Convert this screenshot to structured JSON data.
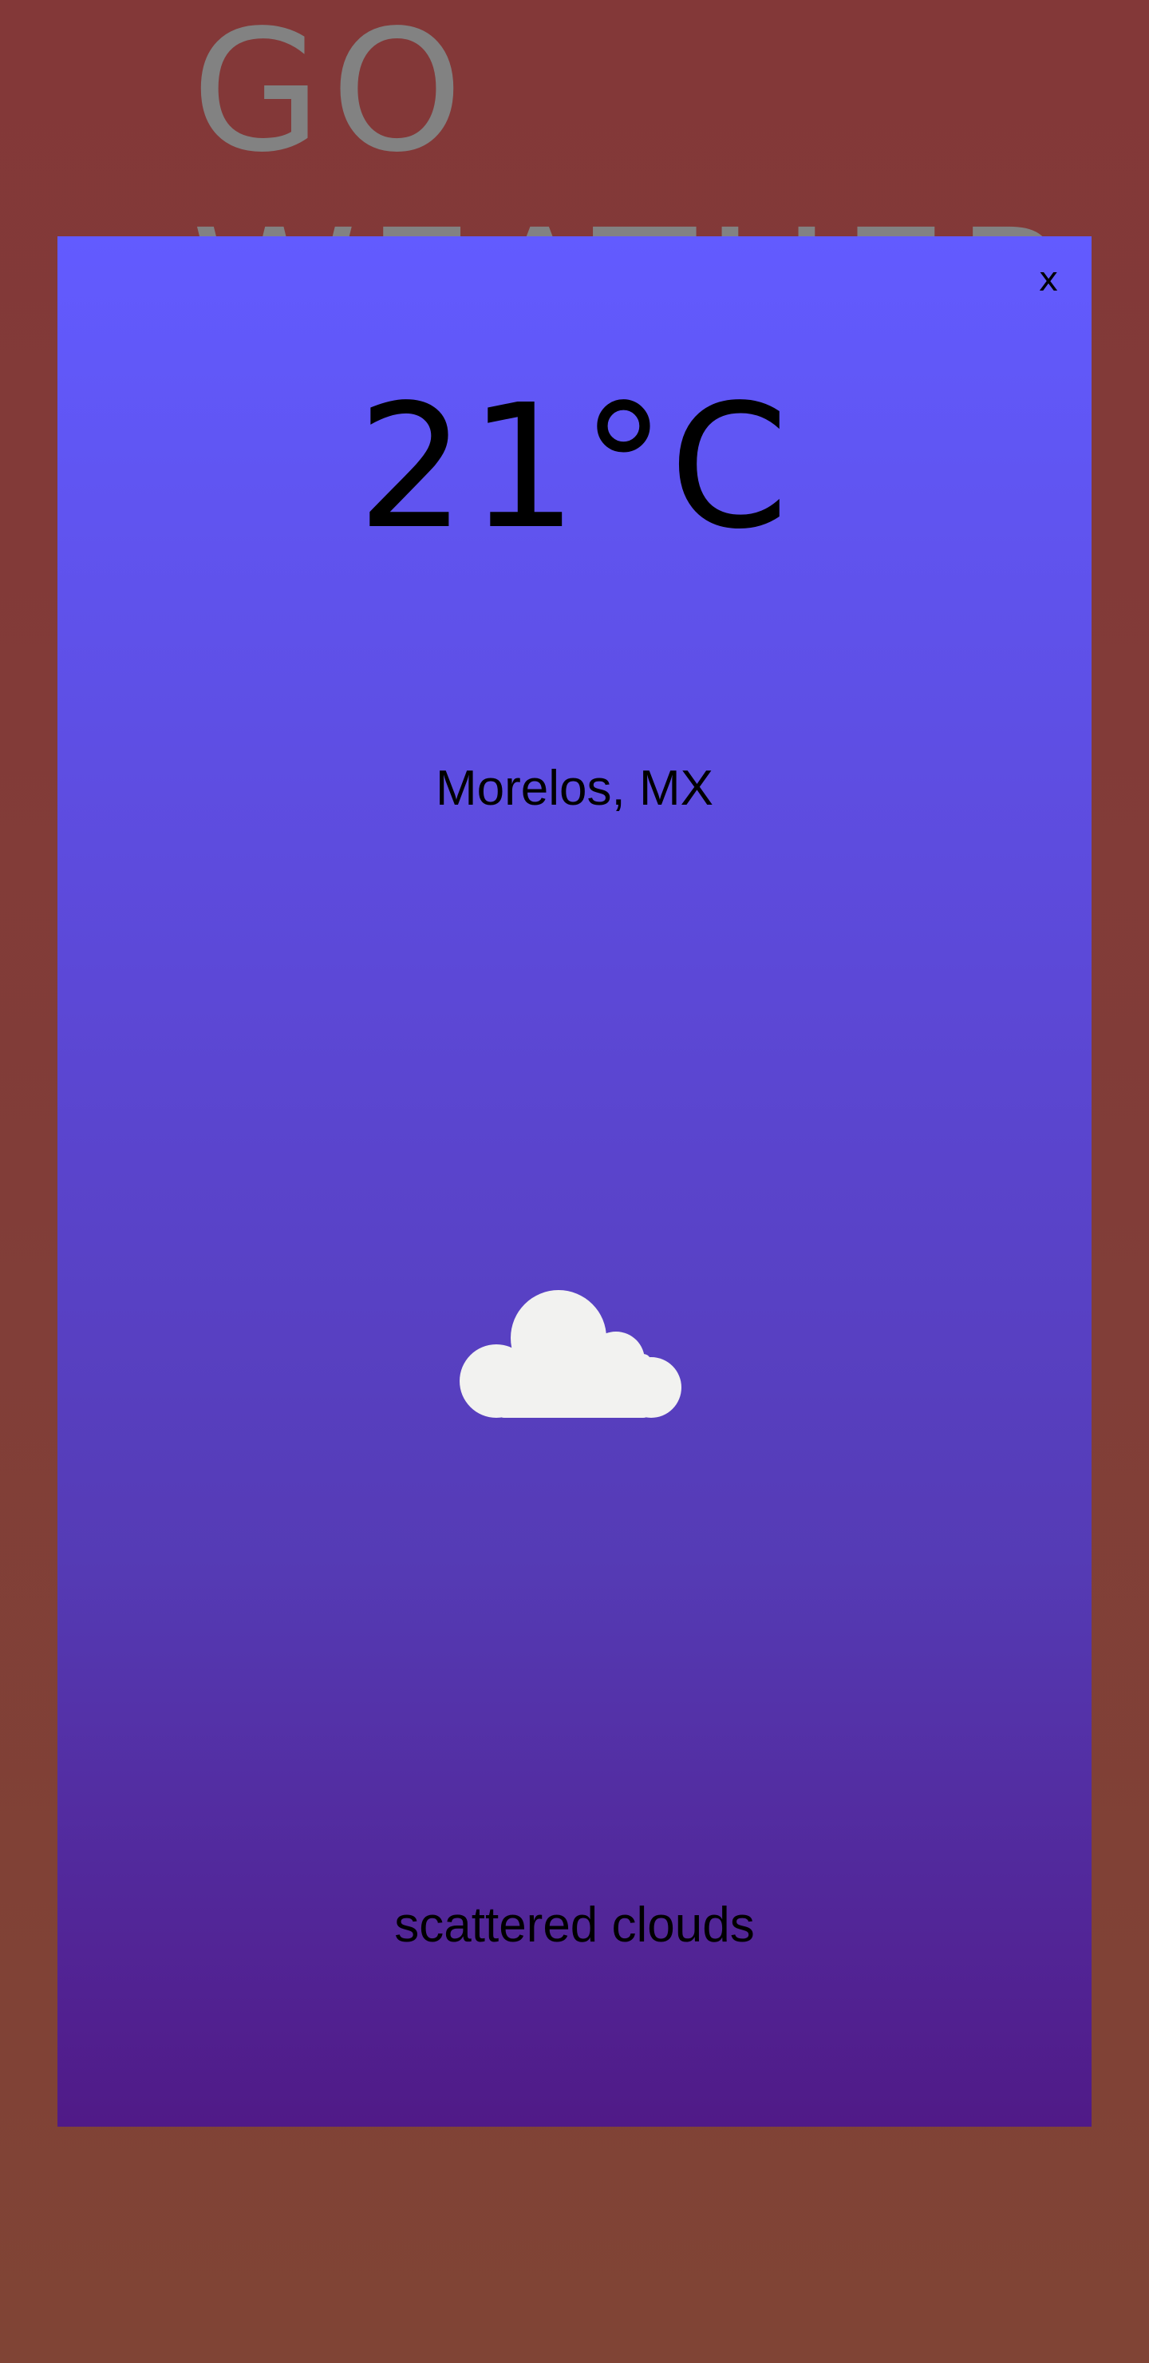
{
  "app": {
    "title": "GO\nWEATHER"
  },
  "modal": {
    "close_label": "x",
    "temperature": "21°C",
    "location": "Morelos, MX",
    "icon": "cloud-icon",
    "description": "scattered clouds"
  },
  "colors": {
    "background_top": "#833838",
    "background_bottom": "#804435",
    "title_text": "#828282",
    "modal_gradient_top": "#625bff",
    "modal_gradient_bottom": "#501a87",
    "cloud": "#f2f2f0"
  }
}
